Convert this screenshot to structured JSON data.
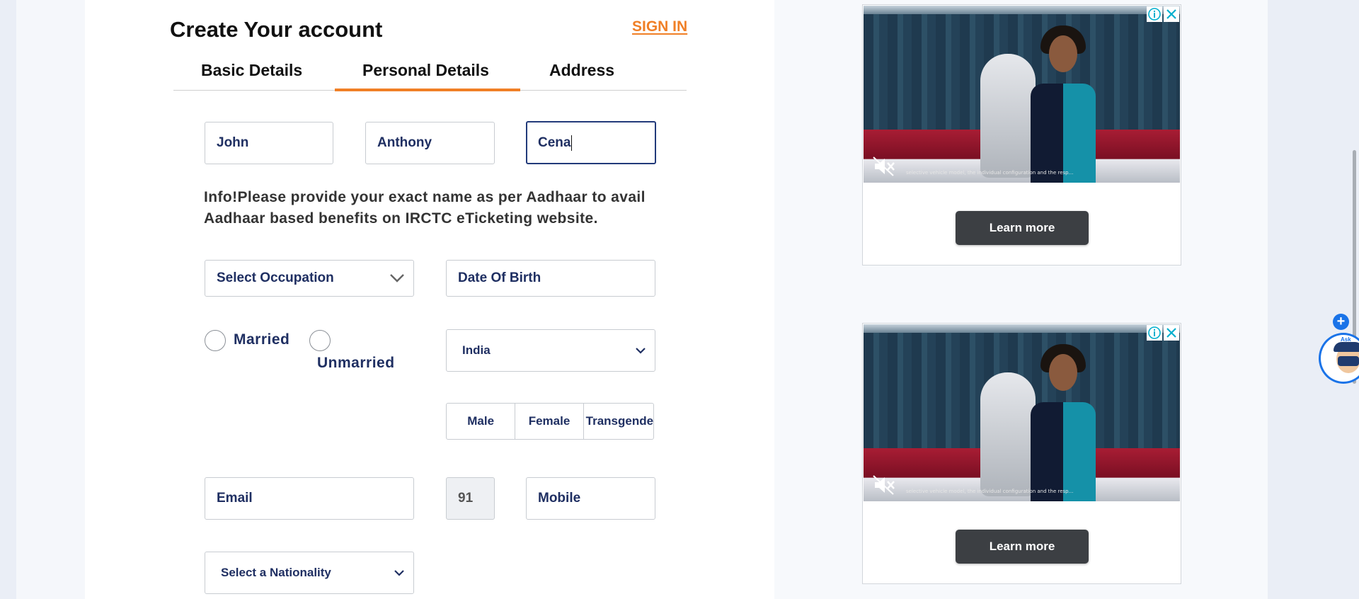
{
  "form": {
    "title": "Create Your account",
    "sign_in": "SIGN IN",
    "tabs": [
      {
        "label": "Basic Details",
        "active": false
      },
      {
        "label": "Personal Details",
        "active": true
      },
      {
        "label": "Address",
        "active": false
      }
    ],
    "first_name": "John",
    "middle_name": "Anthony",
    "last_name": "Cena",
    "info": "Info!Please provide your exact name as per Aadhaar to avail Aadhaar based benefits on IRCTC eTicketing website.",
    "occupation": "Select Occupation",
    "dob": "Date Of Birth",
    "marital": {
      "married": "Married",
      "unmarried": "Unmarried"
    },
    "country": "India",
    "gender": [
      "Male",
      "Female",
      "Transgender"
    ],
    "email": "Email",
    "isd_code": "91",
    "mobile": "Mobile",
    "nationality": "Select a Nationality"
  },
  "ads": [
    {
      "button": "Learn more",
      "fine_print": "selective vehicle model, the individual configuration and the resp..."
    },
    {
      "button": "Learn more",
      "fine_print": "selective vehicle model, the individual configuration and the resp..."
    }
  ],
  "widget": {
    "bot_text": "Ask"
  },
  "colors": {
    "accent": "#f07f26",
    "field_text": "#1f2f62",
    "ad_button": "#3c3f43",
    "widget_blue": "#1a73e8"
  },
  "icons": [
    "chevron-down-icon",
    "info-icon",
    "close-icon",
    "mute-icon",
    "plus-icon",
    "chatbot-avatar-icon"
  ]
}
